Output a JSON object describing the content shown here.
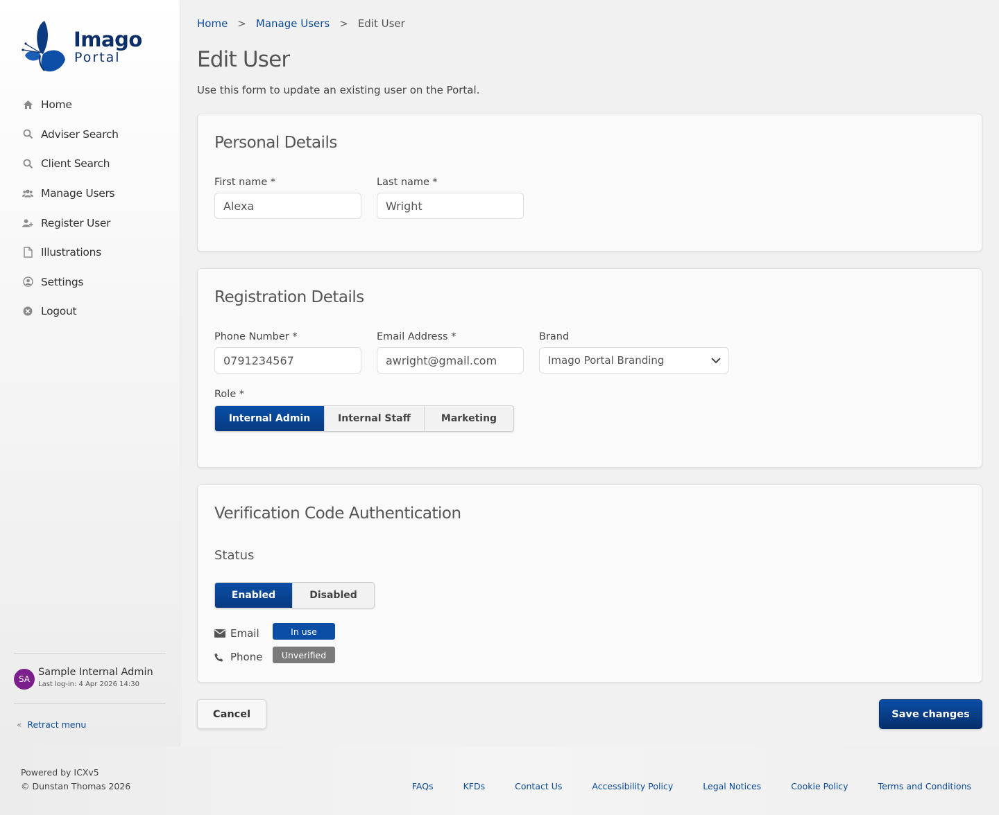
{
  "brand": {
    "line1": "Imago",
    "line2": "Portal",
    "color": "#0b2f66"
  },
  "sidebar": {
    "items": [
      {
        "label": "Home",
        "icon": "home-icon"
      },
      {
        "label": "Adviser Search",
        "icon": "search-icon"
      },
      {
        "label": "Client Search",
        "icon": "search-icon"
      },
      {
        "label": "Manage Users",
        "icon": "users-icon"
      },
      {
        "label": "Register User",
        "icon": "user-plus-icon"
      },
      {
        "label": "Illustrations",
        "icon": "file-icon"
      },
      {
        "label": "Settings",
        "icon": "user-circle-icon"
      },
      {
        "label": "Logout",
        "icon": "close-circle-icon"
      }
    ],
    "user": {
      "initials": "SA",
      "name": "Sample Internal Admin",
      "last_login": "Last log-in: 4 Apr 2026 14:30"
    },
    "retract_label": "Retract menu"
  },
  "breadcrumb": {
    "home": "Home",
    "manage_users": "Manage Users",
    "current": "Edit User",
    "separator": ">"
  },
  "page": {
    "title": "Edit User",
    "description": "Use this form to update an existing user on the Portal."
  },
  "personal": {
    "heading": "Personal Details",
    "first_name_label": "First name  *",
    "first_name_value": "Alexa",
    "last_name_label": "Last name  *",
    "last_name_value": "Wright"
  },
  "registration": {
    "heading": "Registration Details",
    "phone_label": "Phone Number  *",
    "phone_value": "0791234567",
    "email_label": "Email Address  *",
    "email_value": "awright@gmail.com",
    "brand_label": "Brand",
    "brand_value": "Imago Portal Branding",
    "role_label": "Role  *",
    "roles": [
      "Internal Admin",
      "Internal Staff",
      "Marketing"
    ],
    "selected_role": "Internal Admin"
  },
  "verification": {
    "heading": "Verification Code Authentication",
    "status_label": "Status",
    "options": [
      "Enabled",
      "Disabled"
    ],
    "selected": "Enabled",
    "email_label": "Email",
    "email_badge": "In use",
    "email_badge_color": "#0a4ea6",
    "phone_label": "Phone",
    "phone_badge": "Unverified",
    "phone_badge_color": "#7a7a7a"
  },
  "actions": {
    "cancel": "Cancel",
    "save": "Save changes"
  },
  "footer": {
    "powered": "Powered by ICXv5",
    "copyright": "© Dunstan Thomas 2026",
    "links": [
      "FAQs",
      "KFDs",
      "Contact Us",
      "Accessibility Policy",
      "Legal Notices",
      "Cookie Policy",
      "Terms and Conditions"
    ]
  }
}
